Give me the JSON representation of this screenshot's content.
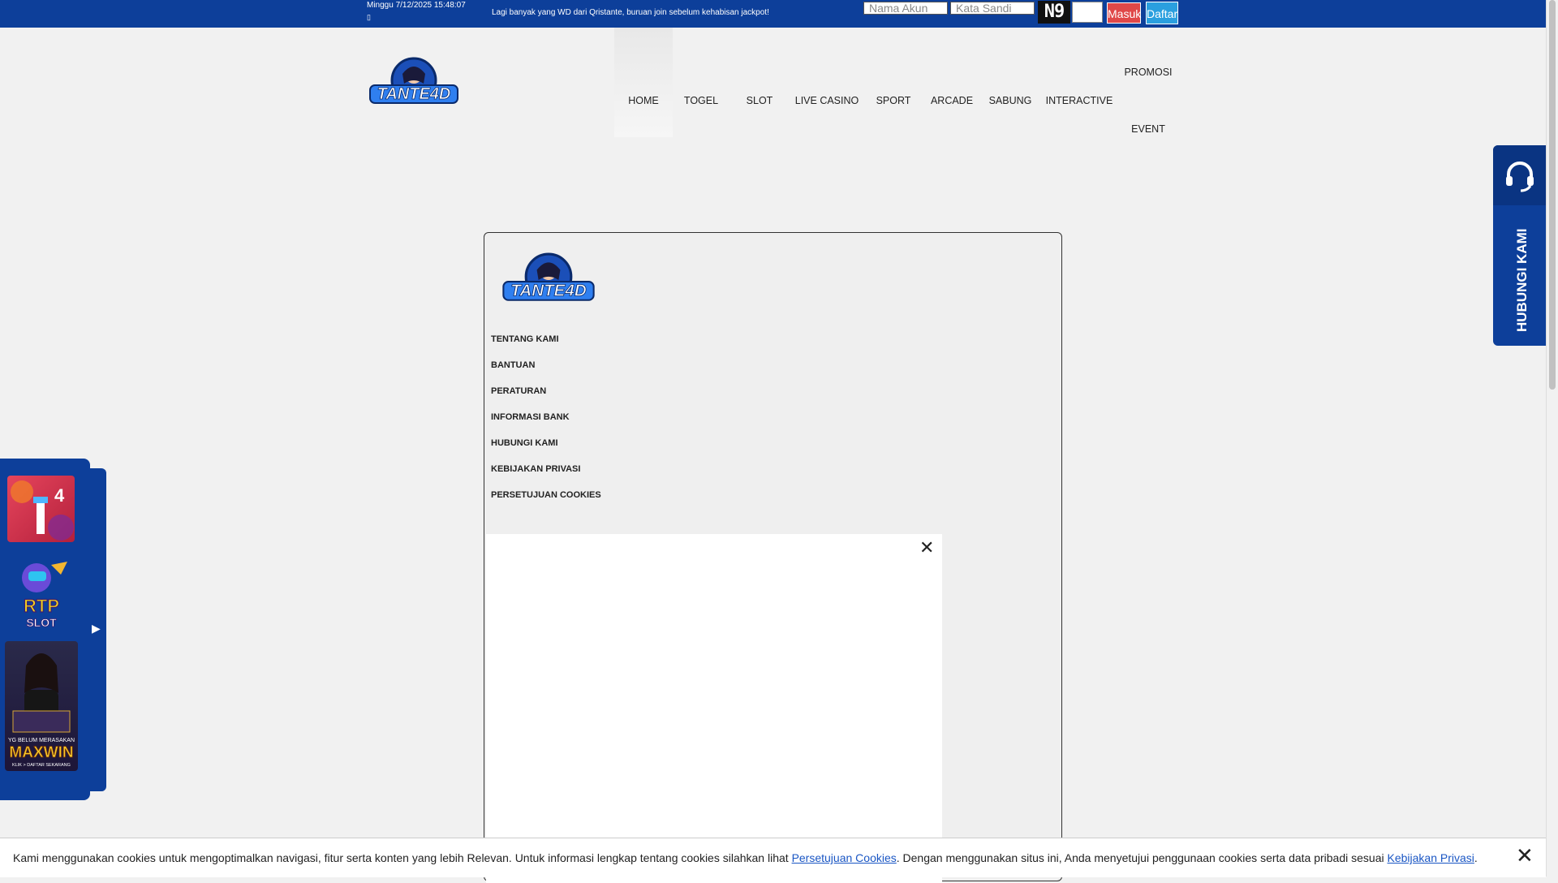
{
  "topbar": {
    "datetime": "Minggu 7/12/2025 15:48:07",
    "marquee": "Lagi banyak yang WD dari Qristante, buruan join sebelum kehabisan jackpot!",
    "username_placeholder": "Nama Akun",
    "password_placeholder": "Kata Sandi",
    "captcha_text": "N9",
    "login_label": "Masuk",
    "register_label": "Daftar"
  },
  "brand": {
    "logo_text": "TANTE4D"
  },
  "nav": {
    "items": [
      "HOME",
      "TOGEL",
      "SLOT",
      "LIVE CASINO",
      "SPORT",
      "ARCADE",
      "SABUNG",
      "INTERACTIVE",
      "PROMOSI",
      "EVENT"
    ]
  },
  "modal": {
    "menu": [
      "TENTANG KAMI",
      "BANTUAN",
      "PERATURAN",
      "INFORMASI BANK",
      "HUBUNGI KAMI",
      "KEBIJAKAN PRIVASI",
      "PERSETUJUAN COOKIES"
    ]
  },
  "contact": {
    "label": "HUBUNGI KAMI"
  },
  "promos": [
    {
      "name": "4D promo",
      "text": "4"
    },
    {
      "name": "RTP slot",
      "text": "RTP SLOT"
    },
    {
      "name": "Maxwin banner",
      "text": "MAXWIN",
      "subtext": "KLIK > DAFTAR SEKARANG",
      "tagline": "YG BELUM MERASAKAN"
    }
  ],
  "cookie": {
    "text_before": "Kami menggunakan cookies untuk mengoptimalkan navigasi, fitur serta konten yang lebih Relevan. Untuk informasi lengkap tentang cookies silahkan lihat",
    "link1": "Persetujuan Cookies",
    "text_middle": ". Dengan menggunakan situs ini, Anda menyetujui penggunaan cookies serta data pribadi sesuai",
    "link2": "Kebijakan Privasi",
    "text_after": "."
  },
  "colors": {
    "primary": "#0d3f9a",
    "login": "#e04848",
    "register": "#2a9fdf"
  }
}
